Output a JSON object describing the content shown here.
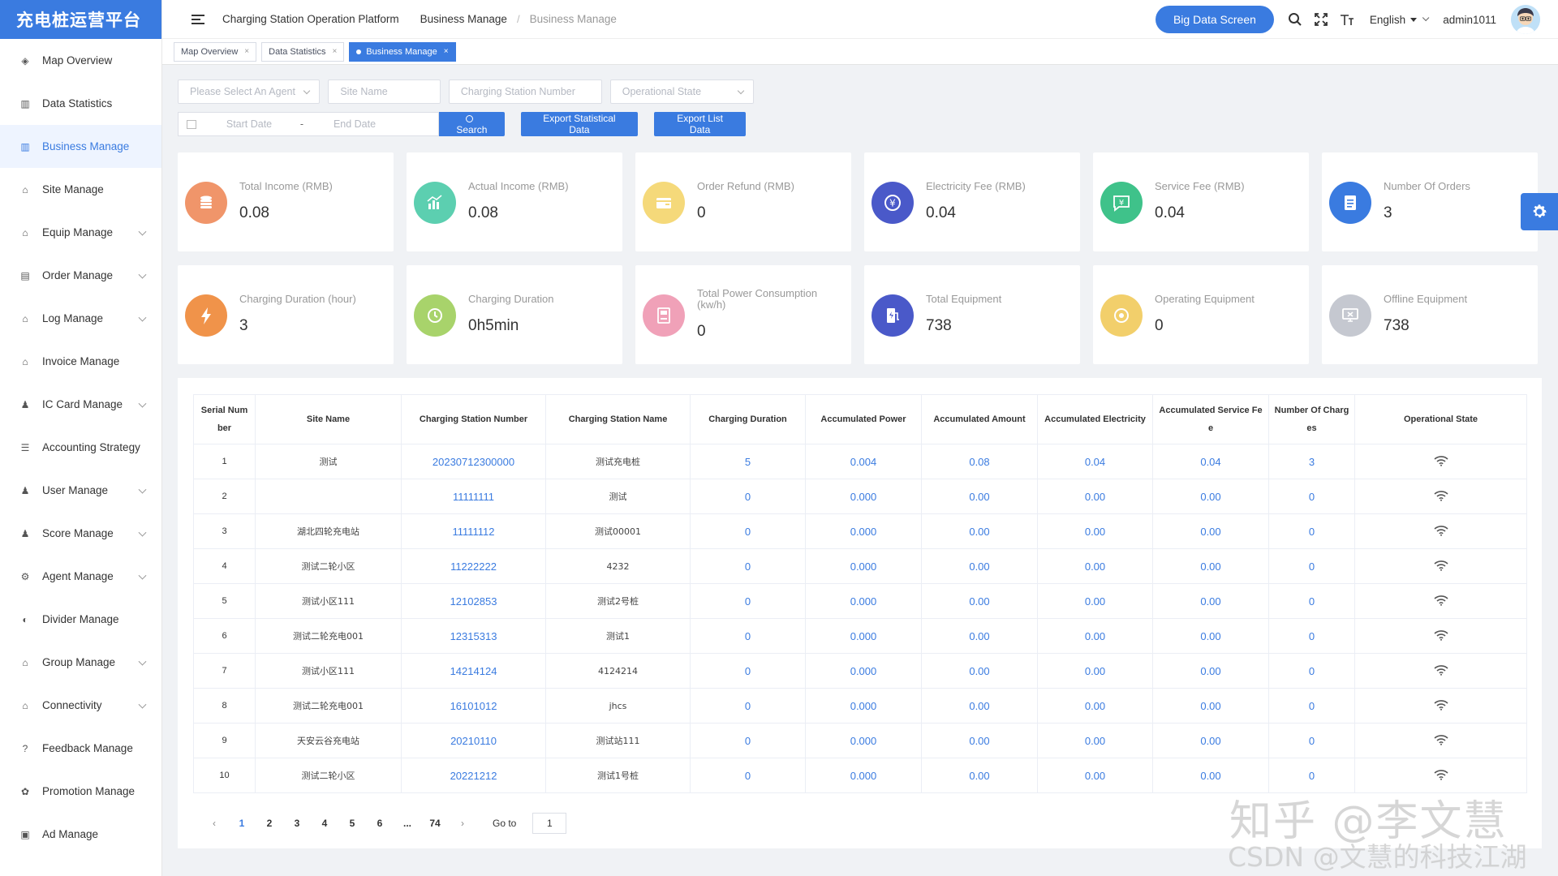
{
  "app": {
    "logo_text": "充电桩运营平台"
  },
  "sidebar": {
    "items": [
      {
        "label": "Map Overview",
        "icon": "map-icon",
        "expandable": false,
        "active": false
      },
      {
        "label": "Data Statistics",
        "icon": "chart-icon",
        "expandable": false,
        "active": false
      },
      {
        "label": "Business Manage",
        "icon": "chart-icon",
        "expandable": false,
        "active": true
      },
      {
        "label": "Site Manage",
        "icon": "site-icon",
        "expandable": false,
        "active": false
      },
      {
        "label": "Equip Manage",
        "icon": "equip-icon",
        "expandable": true,
        "active": false
      },
      {
        "label": "Order Manage",
        "icon": "order-icon",
        "expandable": true,
        "active": false
      },
      {
        "label": "Log Manage",
        "icon": "log-icon",
        "expandable": true,
        "active": false
      },
      {
        "label": "Invoice Manage",
        "icon": "invoice-icon",
        "expandable": false,
        "active": false
      },
      {
        "label": "IC Card Manage",
        "icon": "card-icon",
        "expandable": true,
        "active": false
      },
      {
        "label": "Accounting Strategy",
        "icon": "list-icon",
        "expandable": false,
        "active": false
      },
      {
        "label": "User Manage",
        "icon": "user-icon",
        "expandable": true,
        "active": false
      },
      {
        "label": "Score Manage",
        "icon": "score-icon",
        "expandable": true,
        "active": false
      },
      {
        "label": "Agent Manage",
        "icon": "gear-icon",
        "expandable": true,
        "active": false
      },
      {
        "label": "Divider Manage",
        "icon": "divider-icon",
        "expandable": false,
        "active": false
      },
      {
        "label": "Group Manage",
        "icon": "group-icon",
        "expandable": true,
        "active": false
      },
      {
        "label": "Connectivity",
        "icon": "link-icon",
        "expandable": true,
        "active": false
      },
      {
        "label": "Feedback Manage",
        "icon": "question-icon",
        "expandable": false,
        "active": false
      },
      {
        "label": "Promotion Manage",
        "icon": "promo-icon",
        "expandable": false,
        "active": false
      },
      {
        "label": "Ad Manage",
        "icon": "ad-icon",
        "expandable": false,
        "active": false
      }
    ]
  },
  "header": {
    "breadcrumbs": [
      "Charging Station Operation Platform",
      "Business Manage",
      "Business Manage"
    ],
    "big_data_label": "Big Data Screen",
    "language": "English",
    "username": "admin1011"
  },
  "tags": [
    {
      "label": "Map Overview",
      "active": false
    },
    {
      "label": "Data Statistics",
      "active": false
    },
    {
      "label": "Business Manage",
      "active": true
    }
  ],
  "filters": {
    "agent_placeholder": "Please Select An Agent",
    "site_placeholder": "Site Name",
    "station_placeholder": "Charging Station Number",
    "state_placeholder": "Operational State",
    "start_placeholder": "Start Date",
    "date_sep": "-",
    "end_placeholder": "End Date",
    "search_label": "Search",
    "export_stat_label": "Export Statistical Data",
    "export_list_label": "Export List Data"
  },
  "stats_row1": [
    {
      "label": "Total Income (RMB)",
      "value": "0.08",
      "color": "#f0956a",
      "icon": "coins-icon"
    },
    {
      "label": "Actual Income (RMB)",
      "value": "0.08",
      "color": "#5ccfb0",
      "icon": "bar-chart-icon"
    },
    {
      "label": "Order Refund (RMB)",
      "value": "0",
      "color": "#f5d97a",
      "icon": "wallet-icon"
    },
    {
      "label": "Electricity Fee (RMB)",
      "value": "0.04",
      "color": "#4a59c9",
      "icon": "yen-coin-icon"
    },
    {
      "label": "Service Fee (RMB)",
      "value": "0.04",
      "color": "#3fc28a",
      "icon": "yen-chat-icon"
    },
    {
      "label": "Number Of Orders",
      "value": "3",
      "color": "#3a7be0",
      "icon": "document-icon"
    }
  ],
  "stats_row2": [
    {
      "label": "Charging Duration (hour)",
      "value": "3",
      "color": "#f0934a",
      "icon": "bolt-icon"
    },
    {
      "label": "Charging Duration",
      "value": "0h5min",
      "color": "#a8d36b",
      "icon": "clock-icon"
    },
    {
      "label": "Total Power Consumption (kw/h)",
      "value": "0",
      "color": "#f0a1b8",
      "icon": "meter-icon"
    },
    {
      "label": "Total Equipment",
      "value": "738",
      "color": "#4a59c9",
      "icon": "charger-icon"
    },
    {
      "label": "Operating Equipment",
      "value": "0",
      "color": "#f2cf6b",
      "icon": "gauge-icon"
    },
    {
      "label": "Offline Equipment",
      "value": "738",
      "color": "#c5c8d0",
      "icon": "monitor-icon"
    }
  ],
  "table": {
    "columns": [
      "Serial Number",
      "Site Name",
      "Charging Station Number",
      "Charging Station Name",
      "Charging Duration",
      "Accumulated Power",
      "Accumulated Amount",
      "Accumulated Electricity",
      "Accumulated Service Fee",
      "Number Of Charges",
      "Operational State"
    ],
    "rows": [
      [
        "1",
        "测试",
        "20230712300000",
        "测试充电桩",
        "5",
        "0.004",
        "0.08",
        "0.04",
        "0.04",
        "3"
      ],
      [
        "2",
        "",
        "11111111",
        "测试",
        "0",
        "0.000",
        "0.00",
        "0.00",
        "0.00",
        "0"
      ],
      [
        "3",
        "湖北四轮充电站",
        "11111112",
        "测试00001",
        "0",
        "0.000",
        "0.00",
        "0.00",
        "0.00",
        "0"
      ],
      [
        "4",
        "测试二轮小区",
        "11222222",
        "4232",
        "0",
        "0.000",
        "0.00",
        "0.00",
        "0.00",
        "0"
      ],
      [
        "5",
        "测试小区111",
        "12102853",
        "测试2号桩",
        "0",
        "0.000",
        "0.00",
        "0.00",
        "0.00",
        "0"
      ],
      [
        "6",
        "测试二轮充电001",
        "12315313",
        "测试1",
        "0",
        "0.000",
        "0.00",
        "0.00",
        "0.00",
        "0"
      ],
      [
        "7",
        "测试小区111",
        "14214124",
        "4124214",
        "0",
        "0.000",
        "0.00",
        "0.00",
        "0.00",
        "0"
      ],
      [
        "8",
        "测试二轮充电001",
        "16101012",
        "jhcs",
        "0",
        "0.000",
        "0.00",
        "0.00",
        "0.00",
        "0"
      ],
      [
        "9",
        "天安云谷充电站",
        "20210110",
        "测试站111",
        "0",
        "0.000",
        "0.00",
        "0.00",
        "0.00",
        "0"
      ],
      [
        "10",
        "测试二轮小区",
        "20221212",
        "测试1号桩",
        "0",
        "0.000",
        "0.00",
        "0.00",
        "0.00",
        "0"
      ]
    ]
  },
  "pagination": {
    "pages": [
      "1",
      "2",
      "3",
      "4",
      "5",
      "6",
      "...",
      "74"
    ],
    "current": "1",
    "goto_label": "Go to",
    "goto_value": "1"
  },
  "watermark": {
    "line1": "知乎 @李文慧",
    "line2": "CSDN @文慧的科技江湖"
  },
  "colors": {
    "accent": "#3a7be0"
  }
}
